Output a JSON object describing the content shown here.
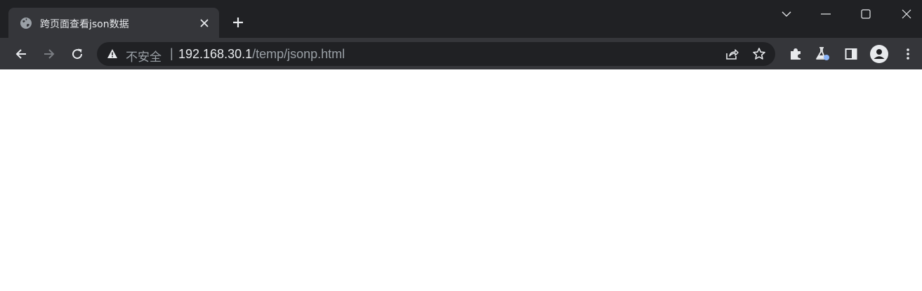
{
  "tab": {
    "title": "跨页面查看json数据",
    "favicon": "globe-icon"
  },
  "window_controls": [
    "chevron-down-icon",
    "minimize-icon",
    "maximize-icon",
    "close-icon"
  ],
  "toolbar": {
    "back": "back-arrow-icon",
    "forward": "forward-arrow-icon",
    "reload": "reload-icon"
  },
  "omnibox": {
    "security_label": "不安全",
    "separator": "|",
    "url_host": "192.168.30.1",
    "url_path": "/temp/jsonp.html"
  },
  "extensions": [
    "puzzle-icon",
    "flask-icon",
    "sidepanel-icon",
    "profile-icon",
    "kebab-menu-icon"
  ],
  "colors": {
    "titlebar": "#202124",
    "toolbar": "#35363a",
    "omnibox": "#202124",
    "text_primary": "#e8eaed",
    "text_secondary": "#9aa0a6"
  }
}
